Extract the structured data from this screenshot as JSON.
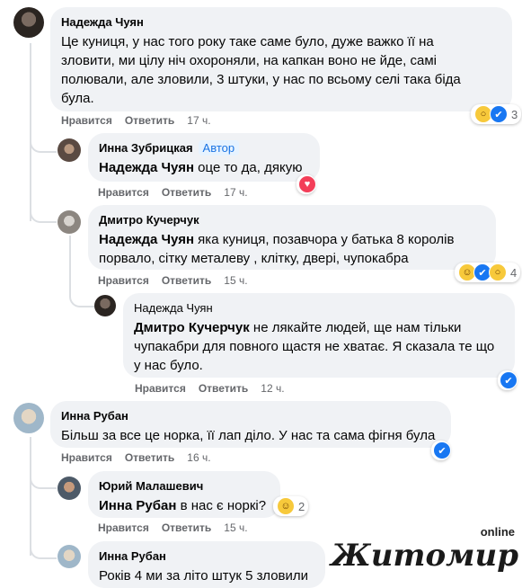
{
  "comments": [
    {
      "author": "Надежда Чуян",
      "lines": [
        "Це куниця, у нас того року таке саме було, дуже важко її на",
        "зловити, ми цілу ніч охороняли, на капкан воно не йде, самі",
        "полювали, але зловили, 3 штуки, у нас по всьому селі така біда",
        "була."
      ],
      "like_label": "Нравится",
      "reply_label": "Ответить",
      "time": "17 ч.",
      "reaction_count": "3"
    },
    {
      "author": "Инна Зубрицкая",
      "badge": "Автор",
      "mention": "Надежда Чуян",
      "text": " оце то да, дякую",
      "like_label": "Нравится",
      "reply_label": "Ответить",
      "time": "17 ч."
    },
    {
      "author": "Дмитро Кучерчук",
      "mention": "Надежда Чуян",
      "text_line1": " яка куниця, позавчора у батька 8 королів",
      "text_line2": "порвало, сітку металеву , клітку, двері, чупокабра",
      "like_label": "Нравится",
      "reply_label": "Ответить",
      "time": "15 ч.",
      "reaction_count": "4"
    },
    {
      "author": "Надежда Чуян",
      "mention": "Дмитро Кучерчук",
      "text_line1": " не лякайте людей, ще нам тільки",
      "text_line2": "чупакабри для повного щастя не хватає. Я сказала те що",
      "text_line3": "у нас було.",
      "like_label": "Нравится",
      "reply_label": "Ответить",
      "time": "12 ч."
    },
    {
      "author": "Инна Рубан",
      "text": "Більш за все це норка, її лап діло. У нас та сама фігня була",
      "like_label": "Нравится",
      "reply_label": "Ответить",
      "time": "16 ч."
    },
    {
      "author": "Юрий Малашевич",
      "mention": "Инна Рубан",
      "text": " в нас є норкі?",
      "like_label": "Нравится",
      "reply_label": "Ответить",
      "time": "15 ч.",
      "reaction_count": "2"
    },
    {
      "author": "Инна Рубан",
      "text": "Років 4 ми за літо штук 5 зловили"
    }
  ],
  "watermark": {
    "main": "Житомир",
    "sub": "online"
  },
  "colors": {
    "bubble": "#f0f2f5",
    "meta": "#65676b",
    "badge": "#1b74e4",
    "like": "#1877f2",
    "love": "#f33e58",
    "wow": "#f7c93b"
  }
}
